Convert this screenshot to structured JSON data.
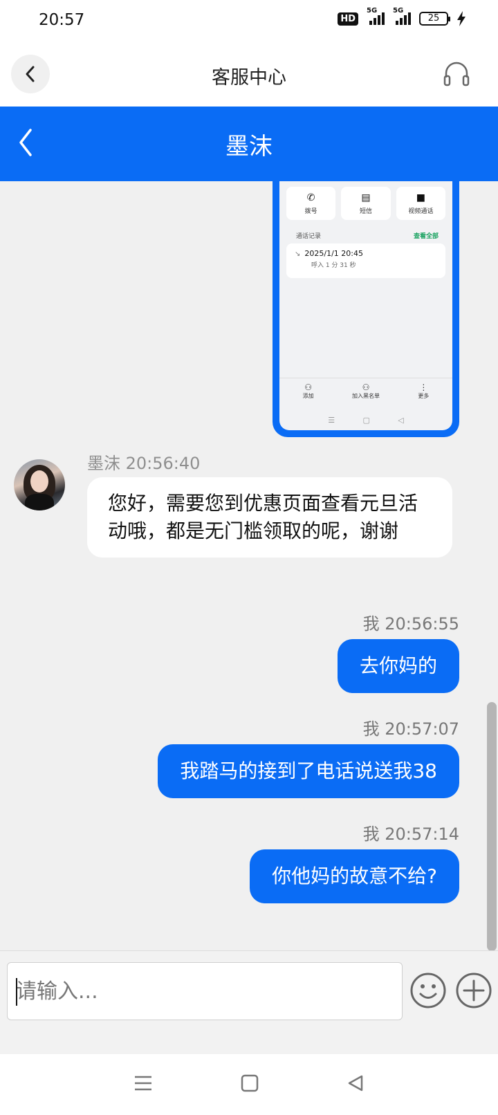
{
  "status_bar": {
    "time": "20:57",
    "hd": "HD",
    "network_1": "5G",
    "network_2": "5G",
    "battery": "25"
  },
  "app_header": {
    "title": "客服中心",
    "back_icon": "chevron-left-icon",
    "support_icon": "headset-icon"
  },
  "chat_header": {
    "title": "墨沫"
  },
  "screenshot": {
    "actions": [
      {
        "label": "拨号",
        "icon": "phone-icon"
      },
      {
        "label": "短信",
        "icon": "message-icon"
      },
      {
        "label": "视频通话",
        "icon": "video-icon"
      }
    ],
    "records_title": "通话记录",
    "view_all": "查看全部",
    "record": {
      "date": "2025/1/1 20:45",
      "detail": "呼入 1 分 31 秒"
    },
    "bottom_actions": [
      {
        "label": "添加",
        "icon": "add-contact-icon"
      },
      {
        "label": "加入黑名单",
        "icon": "block-contact-icon"
      },
      {
        "label": "更多",
        "icon": "more-icon"
      }
    ]
  },
  "messages": [
    {
      "sender": "墨沫",
      "time": "20:56:40",
      "text": "您好，需要您到优惠页面查看元旦活动哦，都是无门槛领取的呢，谢谢",
      "side": "left"
    },
    {
      "sender": "我",
      "time": "20:56:55",
      "text": "去你妈的",
      "side": "right"
    },
    {
      "sender": "我",
      "time": "20:57:07",
      "text": "我踏马的接到了电话说送我38",
      "side": "right"
    },
    {
      "sender": "我",
      "time": "20:57:14",
      "text": "你他妈的故意不给?",
      "side": "right"
    }
  ],
  "input": {
    "placeholder": "请输入..."
  },
  "colors": {
    "accent": "#0a6cf5",
    "chat_bg": "#f0f0f0",
    "bubble_in": "#ffffff"
  }
}
